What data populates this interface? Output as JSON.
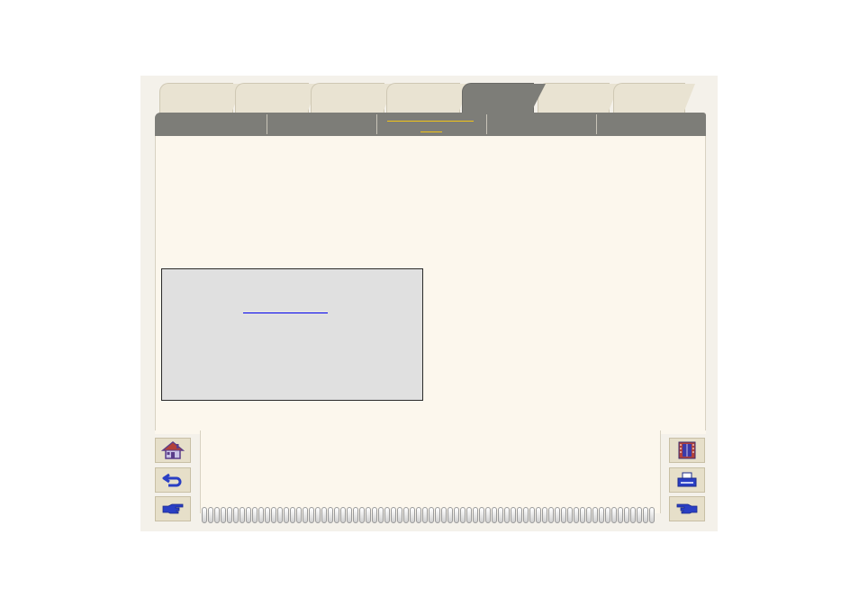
{
  "tabs": [
    {
      "label": ""
    },
    {
      "label": ""
    },
    {
      "label": ""
    },
    {
      "label": ""
    },
    {
      "label": ""
    },
    {
      "label": ""
    },
    {
      "label": ""
    }
  ],
  "active_tab_index": 4,
  "subtabs": [
    {
      "label": ""
    },
    {
      "label": ""
    },
    {
      "label": ""
    },
    {
      "label": ""
    },
    {
      "label": ""
    }
  ],
  "note": {
    "link_text": ""
  },
  "nav_left": [
    {
      "icon": "home-icon"
    },
    {
      "icon": "back-arrow-icon"
    },
    {
      "icon": "pointing-hand-right-icon"
    }
  ],
  "nav_right": [
    {
      "icon": "contents-book-icon"
    },
    {
      "icon": "printer-icon"
    },
    {
      "icon": "pointing-hand-left-icon"
    }
  ],
  "colors": {
    "page": "#fcf7ed",
    "tab": "#e9e3d2",
    "active_tab": "#7d7d78",
    "accent_underline": "#f0c419",
    "link": "#0000ee",
    "note_bg": "#e0e0e0"
  }
}
